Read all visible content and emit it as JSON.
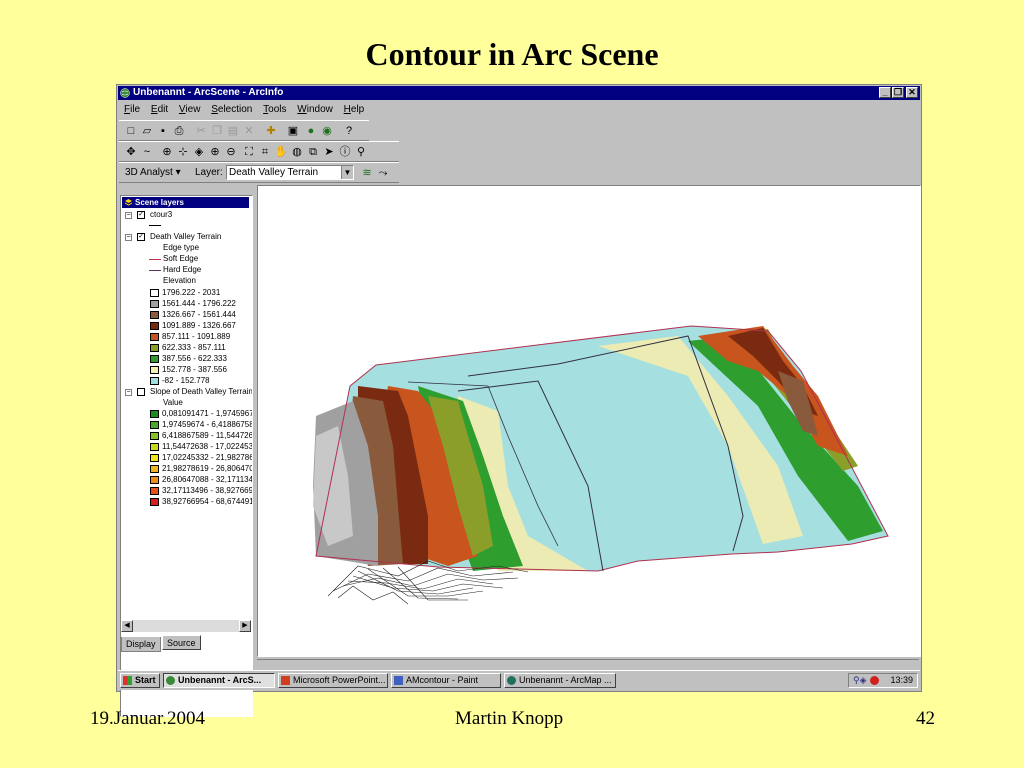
{
  "slide": {
    "title": "Contour in Arc Scene",
    "footer_date": "19.Januar.2004",
    "footer_author": "Martin Knopp",
    "footer_page": "42"
  },
  "window": {
    "title": "Unbenannt - ArcScene - ArcInfo",
    "minimize": "_",
    "restore": "❐",
    "close": "✕"
  },
  "menu": [
    {
      "key": "F",
      "rest": "ile"
    },
    {
      "key": "E",
      "rest": "dit"
    },
    {
      "key": "V",
      "rest": "iew"
    },
    {
      "key": "S",
      "rest": "election"
    },
    {
      "key": "T",
      "rest": "ools"
    },
    {
      "key": "W",
      "rest": "indow"
    },
    {
      "key": "H",
      "rest": "elp"
    }
  ],
  "toolbar3": {
    "analyst_label": "3D Analyst ▾",
    "layer_label": "Layer:",
    "layer_value": "Death Valley Terrain"
  },
  "toc": {
    "header": "Scene layers",
    "layer1": "ctour3",
    "layer2": "Death Valley Terrain",
    "edge_type": "Edge type",
    "soft_edge": "Soft Edge",
    "hard_edge": "Hard Edge",
    "elevation": "Elevation",
    "elev_classes": [
      {
        "label": "1796.222 - 2031",
        "color": "#ffffff"
      },
      {
        "label": "1561.444 - 1796.222",
        "color": "#a0a0a0"
      },
      {
        "label": "1326.667 - 1561.444",
        "color": "#8a5a3c"
      },
      {
        "label": "1091.889 - 1326.667",
        "color": "#7a2a10"
      },
      {
        "label": "857.111 - 1091.889",
        "color": "#c8541e"
      },
      {
        "label": "622.333 - 857.111",
        "color": "#8c9e2a"
      },
      {
        "label": "387.556 - 622.333",
        "color": "#2e9e2e"
      },
      {
        "label": "152.778 - 387.556",
        "color": "#f4f0b0"
      },
      {
        "label": "-82 - 152.778",
        "color": "#9ee0e0"
      }
    ],
    "layer3": "Slope of Death Valley Terrain",
    "value": "Value",
    "slope_classes": [
      {
        "label": "0,081091471 - 1,9745967",
        "color": "#1e8c1e"
      },
      {
        "label": "1,97459674 - 6,41886758",
        "color": "#4aa82a"
      },
      {
        "label": "6,418867589 - 11,544726",
        "color": "#88c02a"
      },
      {
        "label": "11,54472638 - 17,022453",
        "color": "#c8d81e"
      },
      {
        "label": "17,02245332 - 21,982786",
        "color": "#f0e41e"
      },
      {
        "label": "21,98278619 - 26,806470",
        "color": "#f0b41e"
      },
      {
        "label": "26,80647088 - 32,171134",
        "color": "#f08c1e"
      },
      {
        "label": "32,17113496 - 38,927669",
        "color": "#e8501e"
      },
      {
        "label": "38,92766954 - 68,674491",
        "color": "#d81e1e"
      }
    ],
    "tab_display": "Display",
    "tab_source": "Source"
  },
  "taskbar": {
    "start": "Start",
    "items": [
      "Unbenannt - ArcS...",
      "Microsoft PowerPoint...",
      "AMcontour - Paint",
      "Unbenannt - ArcMap ..."
    ],
    "clock": "13:39"
  },
  "icons": {
    "app": "globe-icon",
    "scene_layers": "layers-icon"
  }
}
